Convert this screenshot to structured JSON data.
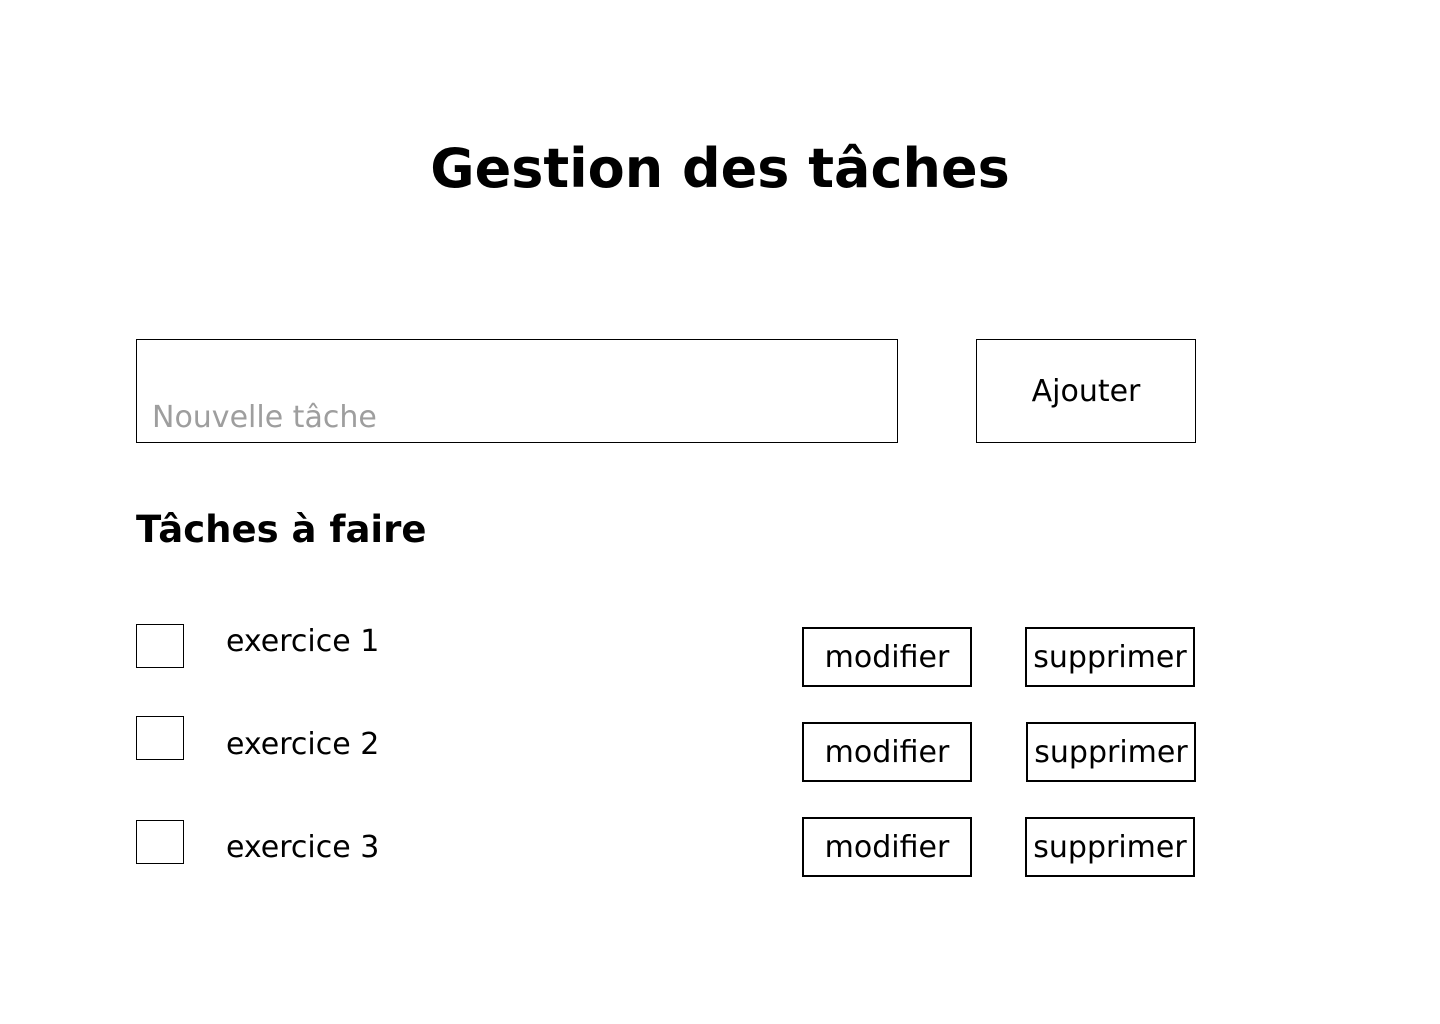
{
  "header": {
    "title": "Gestion des tâches"
  },
  "new_task": {
    "placeholder": "Nouvelle tâche",
    "value": "",
    "add_label": "Ajouter"
  },
  "todo": {
    "title": "Tâches à faire",
    "tasks": [
      {
        "label": "exercice 1",
        "checked": false,
        "edit_label": "modifier",
        "delete_label": "supprimer"
      },
      {
        "label": "exercice 2",
        "checked": false,
        "edit_label": "modifier",
        "delete_label": "supprimer"
      },
      {
        "label": "exercice 3",
        "checked": false,
        "edit_label": "modifier",
        "delete_label": "supprimer"
      }
    ]
  },
  "colors": {
    "background": "#ffffff",
    "text": "#000000",
    "placeholder": "#9e9e9e",
    "border": "#000000"
  }
}
